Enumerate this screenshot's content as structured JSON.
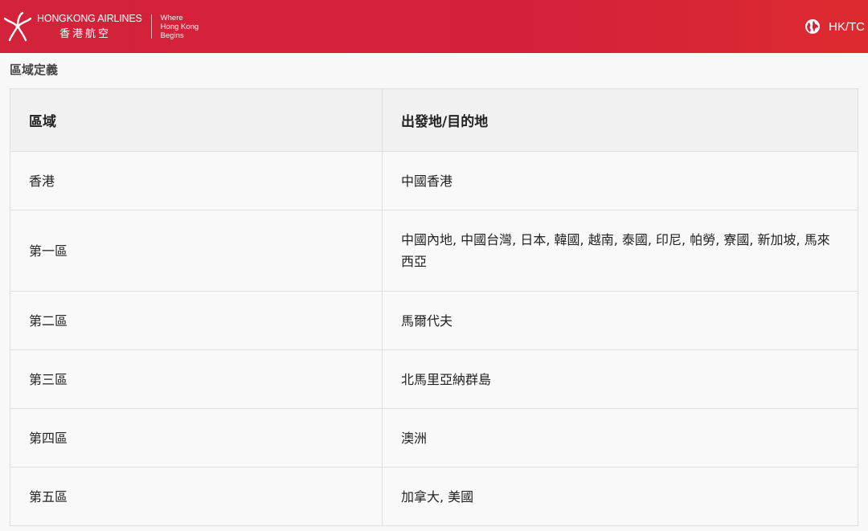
{
  "header": {
    "brand_en": "HONGKONG AIRLINES",
    "brand_zh": "香港航空",
    "tagline": [
      "Where",
      "Hong Kong",
      "Begins"
    ],
    "locale": "HK/TC",
    "brand_color": "#d4213b",
    "icons": {
      "logo": "bauhinia-logo-icon",
      "locale": "globe-icon"
    }
  },
  "section": {
    "title": "區域定義"
  },
  "table": {
    "headers": [
      "區域",
      "出發地/目的地"
    ],
    "rows": [
      {
        "region": "香港",
        "destinations": "中國香港"
      },
      {
        "region": "第一區",
        "destinations": "中國內地, 中國台灣, 日本, 韓國, 越南, 泰國, 印尼, 帕勞, 寮國, 新加坡, 馬來西亞"
      },
      {
        "region": "第二區",
        "destinations": "馬爾代夫"
      },
      {
        "region": "第三區",
        "destinations": "北馬里亞納群島"
      },
      {
        "region": "第四區",
        "destinations": "澳洲"
      },
      {
        "region": "第五區",
        "destinations": "加拿大, 美國"
      }
    ]
  }
}
